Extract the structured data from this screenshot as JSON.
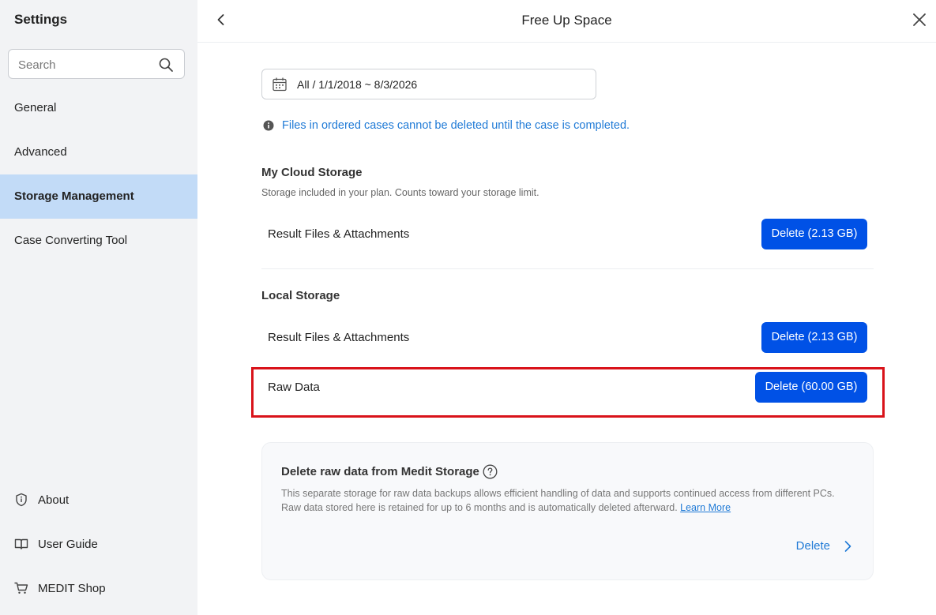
{
  "sidebar": {
    "title": "Settings",
    "search_placeholder": "Search",
    "items": [
      {
        "label": "General"
      },
      {
        "label": "Advanced"
      },
      {
        "label": "Storage Management"
      },
      {
        "label": "Case Converting Tool"
      }
    ],
    "footer": [
      {
        "label": "About",
        "icon": "shield-icon"
      },
      {
        "label": "User Guide",
        "icon": "book-icon"
      },
      {
        "label": "MEDIT Shop",
        "icon": "cart-icon"
      }
    ]
  },
  "header": {
    "title": "Free Up Space"
  },
  "date_range": {
    "value": "All / 1/1/2018 ~ 8/3/2026"
  },
  "notice": "Files in ordered cases cannot be deleted until the case is completed.",
  "cloud": {
    "title": "My Cloud Storage",
    "description": "Storage included in your plan. Counts toward your storage limit.",
    "rows": [
      {
        "label": "Result Files & Attachments",
        "button": "Delete (2.13 GB)"
      }
    ]
  },
  "local": {
    "title": "Local Storage",
    "rows": [
      {
        "label": "Result Files & Attachments",
        "button": "Delete (2.13 GB)"
      },
      {
        "label": "Raw Data",
        "button": "Delete (60.00 GB)"
      }
    ]
  },
  "raw_storage": {
    "title": "Delete raw data from Medit Storage",
    "description": "This separate storage for raw data backups allows efficient handling of data and supports continued access from different PCs. Raw data stored here is retained for up to 6 months and is automatically deleted afterward.",
    "link": "Learn More",
    "action": "Delete"
  },
  "colors": {
    "accent": "#0051e6",
    "link": "#1f7ad6",
    "active_nav": "#c2dbf7",
    "highlight": "#d9131a"
  }
}
